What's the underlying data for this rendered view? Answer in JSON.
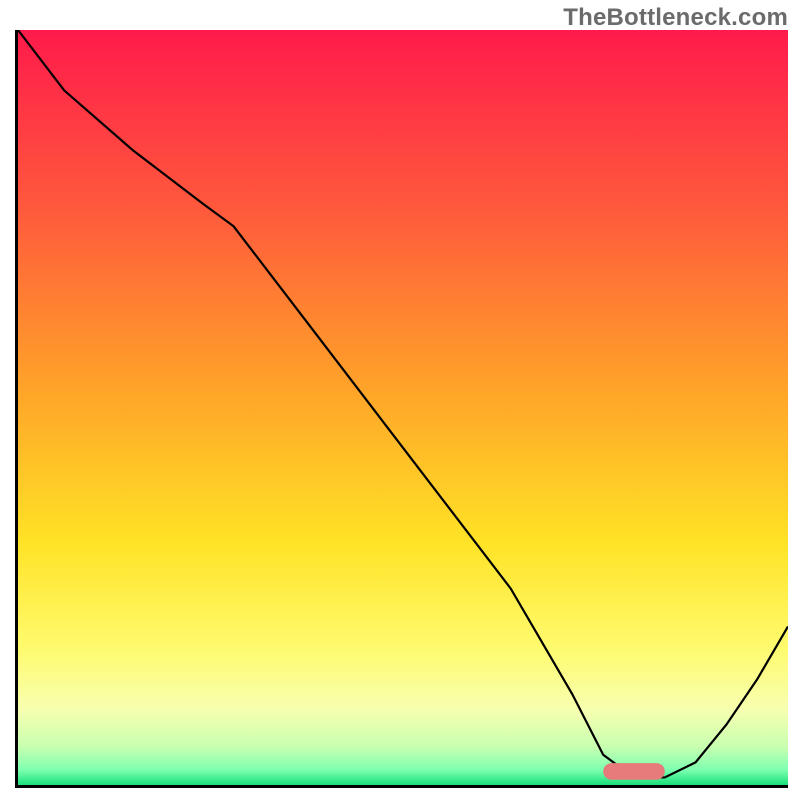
{
  "watermark": "TheBottleneck.com",
  "chart_data": {
    "type": "line",
    "title": "",
    "xlabel": "",
    "ylabel": "",
    "xlim": [
      0,
      100
    ],
    "ylim": [
      0,
      100
    ],
    "grid": false,
    "legend": false,
    "gradient_stops": [
      {
        "offset": 0,
        "color": "#ff1a4b"
      },
      {
        "offset": 24,
        "color": "#ff5a3c"
      },
      {
        "offset": 48,
        "color": "#ffa528"
      },
      {
        "offset": 68,
        "color": "#ffe326"
      },
      {
        "offset": 82,
        "color": "#fffb6f"
      },
      {
        "offset": 90,
        "color": "#f7ffb0"
      },
      {
        "offset": 95,
        "color": "#c8ffb0"
      },
      {
        "offset": 98,
        "color": "#7dffb0"
      },
      {
        "offset": 100,
        "color": "#18e07a"
      }
    ],
    "series": [
      {
        "name": "bottleneck-curve",
        "color": "#000000",
        "width": 2.2,
        "x": [
          0,
          6,
          15,
          24,
          28,
          40,
          52,
          64,
          72,
          76,
          80,
          84,
          88,
          92,
          96,
          100
        ],
        "y": [
          100,
          92,
          84,
          77,
          74,
          58,
          42,
          26,
          12,
          4,
          1,
          1,
          3,
          8,
          14,
          21
        ]
      }
    ],
    "marker": {
      "name": "optimal-range",
      "x": 80,
      "y": 1.8,
      "width": 8,
      "height": 2.2,
      "rx": 1.1,
      "color": "#e77a7a"
    }
  }
}
